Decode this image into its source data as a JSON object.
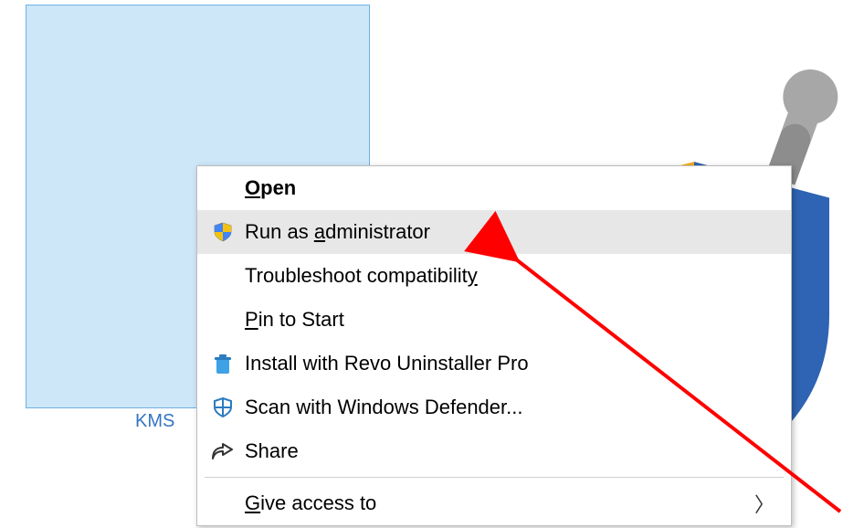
{
  "desktop": {
    "icon_label": "KMS"
  },
  "context_menu": {
    "items": [
      {
        "label_html": "<span class='ul'>O</span>pen",
        "icon": null,
        "bold": true,
        "hover": false,
        "submenu": false
      },
      {
        "label_html": "Run as <span class='ul'>a</span>dministrator",
        "icon": "shield-uac",
        "bold": false,
        "hover": true,
        "submenu": false
      },
      {
        "label_html": "Troubleshoot compatibilit<span class='ul'>y</span>",
        "icon": null,
        "bold": false,
        "hover": false,
        "submenu": false
      },
      {
        "label_html": "<span class='ul'>P</span>in to Start",
        "icon": null,
        "bold": false,
        "hover": false,
        "submenu": false
      },
      {
        "label_html": "Install with Revo Uninstaller Pro",
        "icon": "revo",
        "bold": false,
        "hover": false,
        "submenu": false
      },
      {
        "label_html": "Scan with Windows Defender...",
        "icon": "defender",
        "bold": false,
        "hover": false,
        "submenu": false
      },
      {
        "label_html": "Share",
        "icon": "share",
        "bold": false,
        "hover": false,
        "submenu": false
      },
      {
        "separator": true
      },
      {
        "label_html": "<span class='ul'>G</span>ive access to",
        "icon": null,
        "bold": false,
        "hover": false,
        "submenu": true
      }
    ]
  },
  "bg_icon_desc": "large shield with wrench (defender-style) partially behind menu",
  "annotation": {
    "type": "red-arrow",
    "points_to": "Run as administrator"
  }
}
